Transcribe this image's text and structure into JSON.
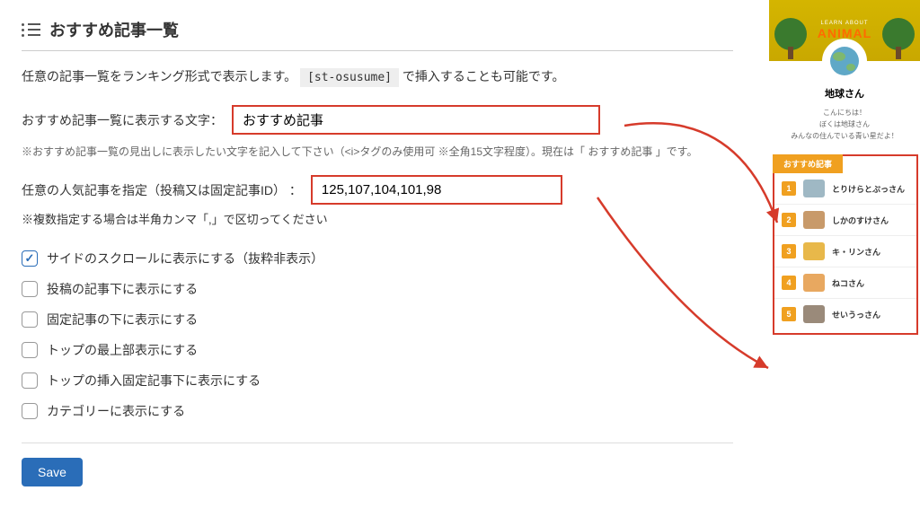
{
  "header": {
    "title": "おすすめ記事一覧"
  },
  "intro": {
    "before": "任意の記事一覧をランキング形式で表示します。 ",
    "shortcode": "[st-osusume]",
    "after": " で挿入することも可能です。"
  },
  "field_title": {
    "label": "おすすめ記事一覧に表示する文字： ",
    "value": "おすすめ記事",
    "hint": "※おすすめ記事一覧の見出しに表示したい文字を記入して下さい（<i>タグのみ使用可 ※全角15文字程度）。現在は「 おすすめ記事 」です。"
  },
  "field_ids": {
    "label": "任意の人気記事を指定（投稿又は固定記事ID） ： ",
    "value": "125,107,104,101,98",
    "hint": "※複数指定する場合は半角カンマ「,」で区切ってください"
  },
  "checks": [
    {
      "label": "サイドのスクロールに表示にする（抜粋非表示）",
      "checked": true
    },
    {
      "label": "投稿の記事下に表示にする",
      "checked": false
    },
    {
      "label": "固定記事の下に表示にする",
      "checked": false
    },
    {
      "label": "トップの最上部表示にする",
      "checked": false
    },
    {
      "label": "トップの挿入固定記事下に表示にする",
      "checked": false
    },
    {
      "label": "カテゴリーに表示にする",
      "checked": false
    }
  ],
  "save_label": "Save",
  "preview": {
    "banner_line1": "LEARN ABOUT",
    "banner_line2": "ANIMAL",
    "profile_name": "地球さん",
    "tagline_1": "こんにちは！",
    "tagline_2": "ぼくは地球さん",
    "tagline_3": "みんなの住んでいる青い星だよ！",
    "widget_title": "おすすめ記事",
    "items": [
      {
        "n": "1",
        "title": "とりけらとぷっさん",
        "color": "#9fb8c4"
      },
      {
        "n": "2",
        "title": "しかのすけさん",
        "color": "#c89a6a"
      },
      {
        "n": "3",
        "title": "キ・リンさん",
        "color": "#e8b84a"
      },
      {
        "n": "4",
        "title": "ねコさん",
        "color": "#e8a860"
      },
      {
        "n": "5",
        "title": "せいうっさん",
        "color": "#9a8a7a"
      }
    ]
  }
}
